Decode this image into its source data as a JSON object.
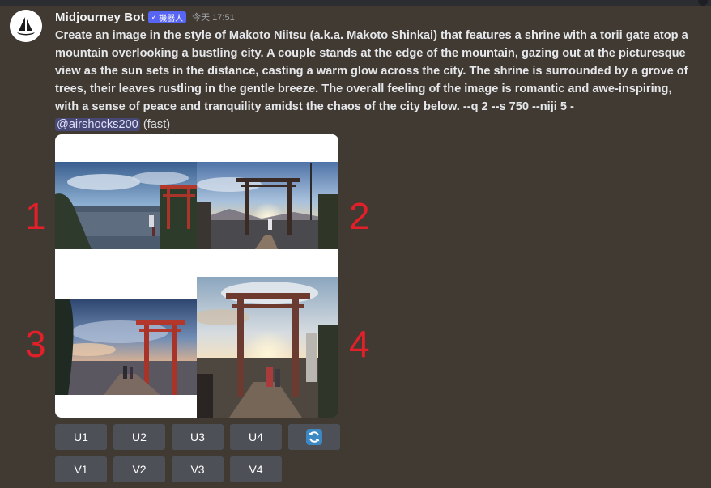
{
  "header": {
    "username": "Midjourney Bot",
    "badge_check": "✓",
    "badge_label": "機器人",
    "timestamp": "今天 17:51"
  },
  "message": {
    "prompt": "Create an image in the style of Makoto Niitsu (a.k.a. Makoto Shinkai) that features a shrine with a torii gate atop a mountain overlooking a bustling city. A couple stands at the edge of the mountain, gazing out at the picturesque view as the sun sets in the distance, casting a warm glow across the city. The shrine is surrounded by a grove of trees, their leaves rustling in the gentle breeze. The overall feeling of the image is romantic and awe-inspiring, with a sense of peace and tranquility amidst the chaos of the city below. --q 2 --s 750 --niji 5 -",
    "mention": "@airshocks200",
    "speed": "(fast)"
  },
  "annotations": [
    "1",
    "2",
    "3",
    "4"
  ],
  "buttons": {
    "upscale": [
      "U1",
      "U2",
      "U3",
      "U4"
    ],
    "variation": [
      "V1",
      "V2",
      "V3",
      "V4"
    ],
    "reroll_icon": "refresh-icon"
  },
  "colors": {
    "background": "#403a33",
    "button": "#4e5058",
    "bot_badge": "#5865f2",
    "annotation": "#e3202a",
    "reroll": "#3b88c3"
  }
}
